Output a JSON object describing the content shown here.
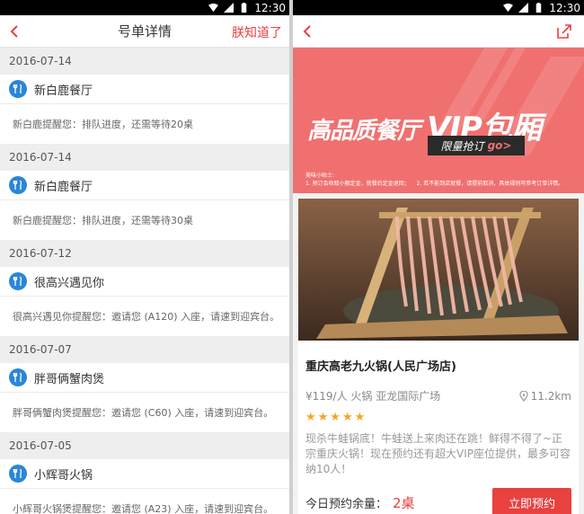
{
  "status_bar": {
    "time": "12:30"
  },
  "left": {
    "title": "号单详情",
    "action": "朕知道了",
    "entries": [
      {
        "date": "2016-07-14",
        "shop": "新白鹿餐厅",
        "message": "新白鹿提醒您：排队进度，还需等待20桌"
      },
      {
        "date": "2016-07-14",
        "shop": "新白鹿餐厅",
        "message": "新白鹿提醒您：排队进度，还需等待30桌"
      },
      {
        "date": "2016-07-12",
        "shop": "很高兴遇见你",
        "message": "很高兴遇见你提醒您：邀请您 (A120) 入座，请速到迎宾台。"
      },
      {
        "date": "2016-07-07",
        "shop": "胖哥俩蟹肉煲",
        "message": "胖哥俩蟹肉煲提醒您：邀请您 (C60) 入座，请速到迎宾台。"
      },
      {
        "date": "2016-07-05",
        "shop": "小辉哥火锅",
        "message": "小辉哥火锅煲提醒您：邀请您 (A23) 入座，请速到迎宾台。"
      }
    ]
  },
  "right": {
    "banner": {
      "title_cn": "高品质餐厅",
      "title_vip": "VIP包厢",
      "badge": "限量抢订",
      "badge_go": "go>",
      "tips_heading": "美味小贴士:",
      "tips_1": "1. 预订会收取小额定金，就餐后定金退回；",
      "tips_2": "2. 若不能到店就餐，请提前取消，具体规则可参考订单详情。"
    },
    "restaurant": {
      "name": "重庆高老九火锅(人民广场店)",
      "price": "¥119/人",
      "cuisine": "火锅",
      "area": "亚龙国际广场",
      "distance": "11.2km",
      "rating": 5,
      "stars": "★★★★★",
      "description": "现杀牛蛙锅底！牛蛙送上来肉还在跳！鲜得不得了~正宗重庆火锅！现在预约还有超大VIP座位提供，最多可容纳10人！",
      "remain_label": "今日预约余量：",
      "remain_value": "2桌",
      "book_button": "立即预约"
    }
  },
  "colors": {
    "accent": "#e8413f",
    "icon_blue": "#2b86d8",
    "banner": "#f07070",
    "star": "#f5a623"
  }
}
